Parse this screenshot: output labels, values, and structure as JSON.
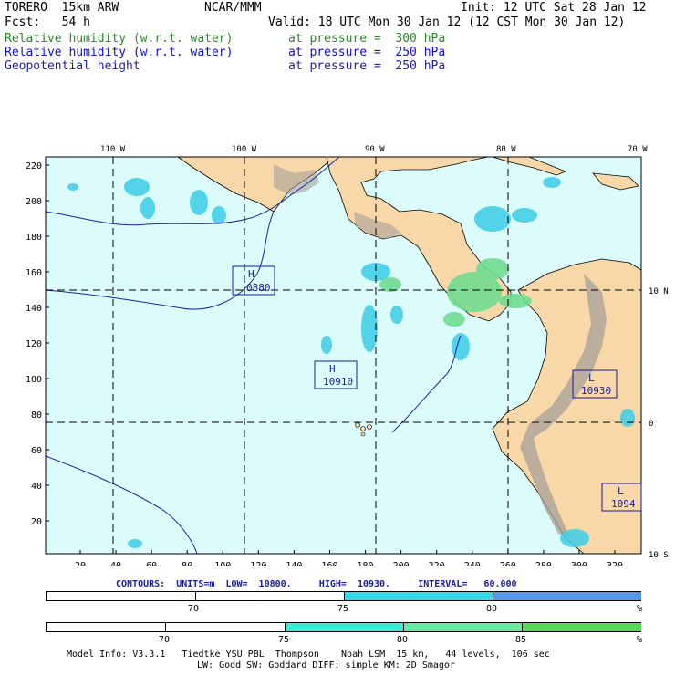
{
  "header": {
    "model": "TORERO  15km ARW",
    "org": "NCAR/MMM",
    "init": "Init: 12 UTC Sat 28 Jan 12",
    "fcst": "Fcst:   54 h",
    "valid": "Valid: 18 UTC Mon 30 Jan 12 (12 CST Mon 30 Jan 12)"
  },
  "fields": [
    {
      "name": "Relative humidity (w.r.t. water)",
      "level": "at pressure =  300 hPa",
      "color": "#2a8a2a"
    },
    {
      "name": "Relative humidity (w.r.t. water)",
      "level": "at pressure =  250 hPa",
      "color": "#1010d0"
    },
    {
      "name": "Geopotential height",
      "level": "at pressure =  250 hPa",
      "color": "#2020a0"
    }
  ],
  "map": {
    "top_lon_labels": [
      "110 W",
      "100 W",
      "90 W",
      "80 W",
      "70 W"
    ],
    "right_lat_labels": [
      "10 N",
      "0",
      "10 S"
    ],
    "y_ticks": [
      "220",
      "200",
      "180",
      "160",
      "140",
      "120",
      "100",
      "80",
      "60",
      "40",
      "20"
    ],
    "x_ticks": [
      "20",
      "40",
      "60",
      "80",
      "100",
      "120",
      "140",
      "160",
      "180",
      "200",
      "220",
      "240",
      "260",
      "280",
      "300",
      "320"
    ],
    "pressure_centers": [
      {
        "type": "H",
        "value": "0880"
      },
      {
        "type": "H",
        "value": "10910"
      },
      {
        "type": "L",
        "value": "10930"
      },
      {
        "type": "L",
        "value": "1094"
      }
    ],
    "colors": {
      "ocean": "#dcfcfc",
      "land": "#f8d8a8",
      "mountain": "#a8a098",
      "rh250": "#3ccce8",
      "rh300": "#70dc90"
    }
  },
  "contours": {
    "label": "CONTOURS:",
    "units": "UNITS=m",
    "low": "LOW=  10800.",
    "high": "HIGH=  10930.",
    "interval": "INTERVAL=   60.000"
  },
  "colorbar1": {
    "labels": [
      "70",
      "75",
      "80"
    ],
    "unit": "%",
    "colors": [
      "#ffffff",
      "#38d8ec",
      "#5898ec"
    ]
  },
  "colorbar2": {
    "labels": [
      "70",
      "75",
      "80",
      "85"
    ],
    "unit": "%",
    "colors": [
      "#ffffff",
      "#38ecd8",
      "#68e8a0",
      "#58d858"
    ]
  },
  "footer": {
    "line1": "Model Info: V3.3.1   Tiedtke YSU PBL  Thompson    Noah LSM  15 km,   44 levels,  106 sec",
    "line2": "LW: Godd SW: Goddard DIFF: simple KM: 2D Smagor"
  }
}
